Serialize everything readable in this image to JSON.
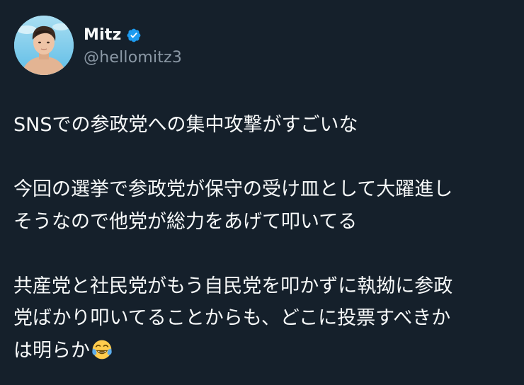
{
  "author": {
    "display_name": "Mitz",
    "handle": "@hellomitz3",
    "verified": true,
    "verified_badge_color": "#1d9bf0"
  },
  "tweet": {
    "paragraphs": [
      {
        "lines": [
          "SNSでの参政党への集中攻撃がすごいな"
        ]
      },
      {
        "lines": [
          "今回の選挙で参政党が保守の受け皿として大躍進し",
          "そうなので他党が総力をあげて叩いてる"
        ]
      },
      {
        "lines": [
          "共産党と社民党がもう自民党を叩かずに執拗に参政",
          "党ばかり叩いてることからも、どこに投票すべきか",
          "は明らか"
        ]
      }
    ],
    "trailing_emoji": "face-with-tears-of-joy"
  },
  "theme": {
    "background": "#15202b",
    "text_primary": "#f7f9f9",
    "text_secondary": "#8b98a5"
  }
}
